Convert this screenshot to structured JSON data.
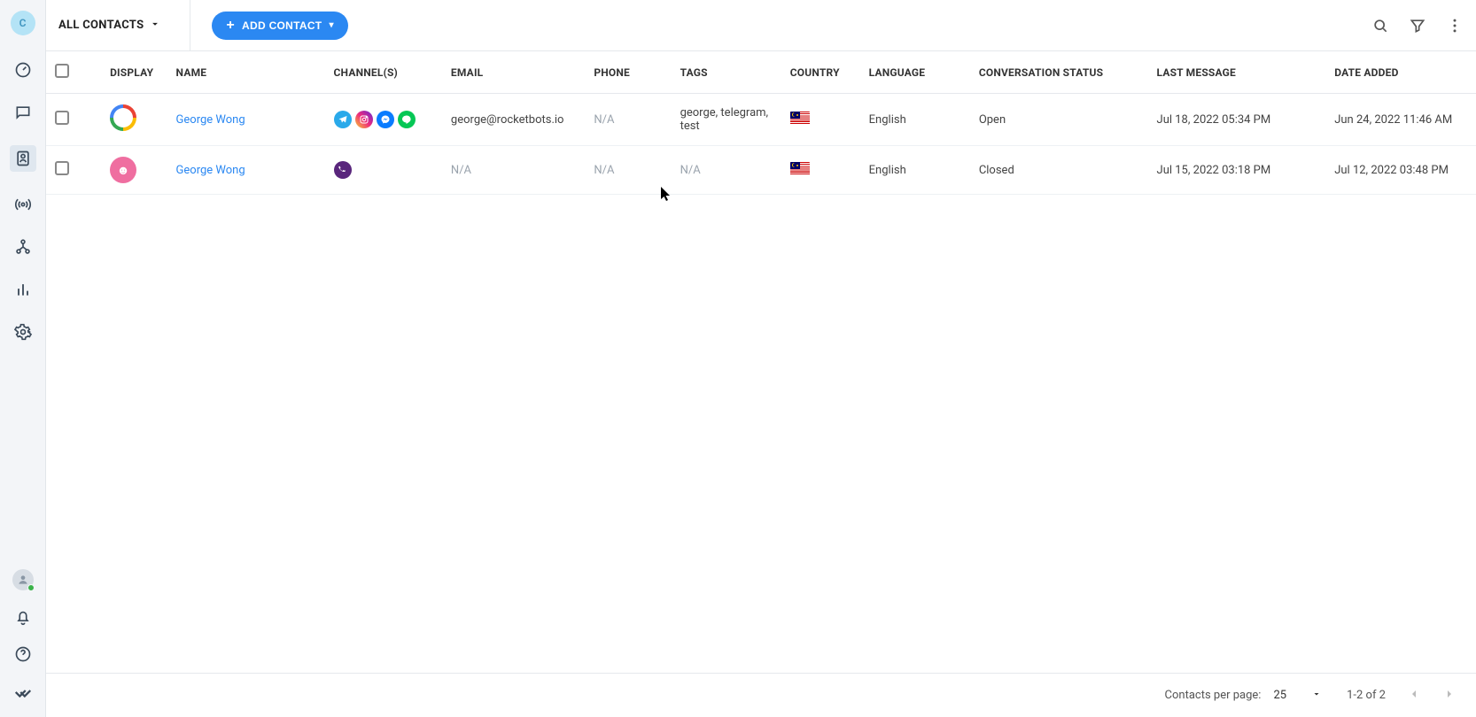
{
  "workspace_initial": "C",
  "header": {
    "title": "ALL CONTACTS",
    "add_contact": "ADD CONTACT"
  },
  "columns": {
    "display": "DISPLAY",
    "name": "NAME",
    "channels": "CHANNEL(S)",
    "email": "EMAIL",
    "phone": "PHONE",
    "tags": "TAGS",
    "country": "COUNTRY",
    "language": "LANGUAGE",
    "conversation_status": "CONVERSATION STATUS",
    "last_message": "LAST MESSAGE",
    "date_added": "DATE ADDED"
  },
  "rows": [
    {
      "avatar_bg": "#e35b8f",
      "avatar_style": "google",
      "name": "George Wong",
      "channels": [
        "telegram",
        "instagram",
        "messenger",
        "line"
      ],
      "email": "george@rocketbots.io",
      "phone": "N/A",
      "tags": "george, telegram, test",
      "country": "MY",
      "language": "English",
      "status": "Open",
      "last_message": "Jul 18, 2022 05:34 PM",
      "date_added": "Jun 24, 2022 11:46 AM"
    },
    {
      "avatar_bg": "#ef6ea0",
      "avatar_style": "solid",
      "name": "George Wong",
      "channels": [
        "viber"
      ],
      "email": "N/A",
      "phone": "N/A",
      "tags": "N/A",
      "country": "MY",
      "language": "English",
      "status": "Closed",
      "last_message": "Jul 15, 2022 03:18 PM",
      "date_added": "Jul 12, 2022 03:48 PM"
    }
  ],
  "footer": {
    "per_page_label": "Contacts per page:",
    "per_page_value": "25",
    "range": "1-2 of 2"
  },
  "channel_colors": {
    "telegram": "#29a9ea",
    "instagram": "linear-gradient(45deg,#f9ce34,#ee2a7b,#6228d7)",
    "messenger": "#0a7cff",
    "line": "#06c755",
    "viber": "#59267c"
  }
}
